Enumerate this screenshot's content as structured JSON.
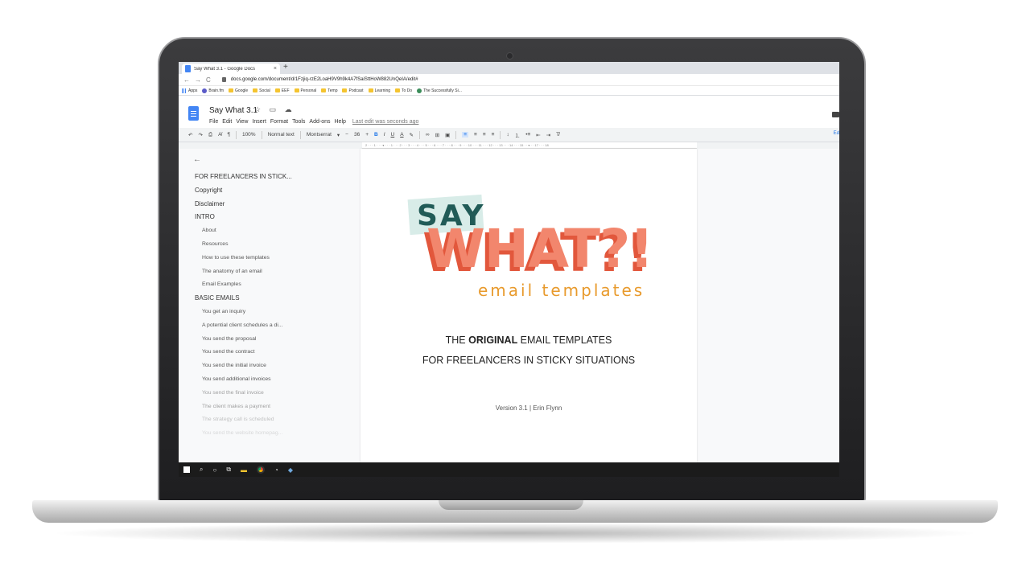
{
  "browser": {
    "tab_title": "Say What 3.1 - Google Docs",
    "tab_close": "×",
    "new_tab": "+",
    "url": "docs.google.com/document/d/1Fzjiq-rzE2LoaH9V9h9k4A7fSaiSttHoW882UnQeIA/edit#",
    "bookmarks": [
      "Apps",
      "Brain.fm",
      "Google",
      "Social",
      "EEF",
      "Personal",
      "Temp",
      "Podcast",
      "Learning",
      "To Do",
      "The Successfully Si..."
    ]
  },
  "docs": {
    "title": "Say What 3.1",
    "title_icons": "☆ ▭ ☁",
    "menu": [
      "File",
      "Edit",
      "View",
      "Insert",
      "Format",
      "Tools",
      "Add-ons",
      "Help"
    ],
    "last_edit": "Last edit was seconds ago"
  },
  "toolbar": {
    "zoom": "100%",
    "style": "Normal text",
    "font": "Montserrat",
    "size": "36",
    "edit_label": "Ed"
  },
  "ruler": "2 · · · 1 · · · ▾ · · · 1 · · · 2 · · · 3 · · · 4 · · · 5 · · · 6 · · · 7 · · · 8 · · · 9 · · · 10 · · · 11 · · · 12 · · · 13 · · · 14 · · · 15 · · ▾ · · 17 · · · 18",
  "outline": {
    "back": "←",
    "items": [
      {
        "label": "FOR FREELANCERS IN STICK...",
        "level": 1
      },
      {
        "label": "Copyright",
        "level": 1
      },
      {
        "label": "Disclaimer",
        "level": 1
      },
      {
        "label": "INTRO",
        "level": 1
      },
      {
        "label": "About",
        "level": 2
      },
      {
        "label": "Resources",
        "level": 2
      },
      {
        "label": "How to use these templates",
        "level": 2
      },
      {
        "label": "The anatomy of an email",
        "level": 2
      },
      {
        "label": "Email Examples",
        "level": 2
      },
      {
        "label": "BASIC EMAILS",
        "level": 1
      },
      {
        "label": "You get an inquiry",
        "level": 2
      },
      {
        "label": "A potential client schedules a di...",
        "level": 2
      },
      {
        "label": "You send the proposal",
        "level": 2
      },
      {
        "label": "You send the contract",
        "level": 2
      },
      {
        "label": "You send the initial invoice",
        "level": 2
      },
      {
        "label": "You send additional invoices",
        "level": 2
      },
      {
        "label": "You send the final invoice",
        "level": 2
      },
      {
        "label": "The client makes a payment",
        "level": 2
      },
      {
        "label": "The strategy call is scheduled",
        "level": 2
      },
      {
        "label": "You send the website homepag...",
        "level": 2
      }
    ]
  },
  "page": {
    "logo_say": "SAY",
    "logo_what": "WHAT?!",
    "logo_sub": "email templates",
    "tagline_pre": "THE ",
    "tagline_bold": "ORIGINAL",
    "tagline_post": " EMAIL TEMPLATES",
    "tagline2": "FOR FREELANCERS IN STICKY SITUATIONS",
    "version": "Version 3.1 | Erin Flynn"
  },
  "colors": {
    "say_teal": "#215b57",
    "what_coral": "#f2866d",
    "what_shadow": "#e2573c",
    "sub_gold": "#e89a2c",
    "docs_blue": "#4285f4"
  }
}
